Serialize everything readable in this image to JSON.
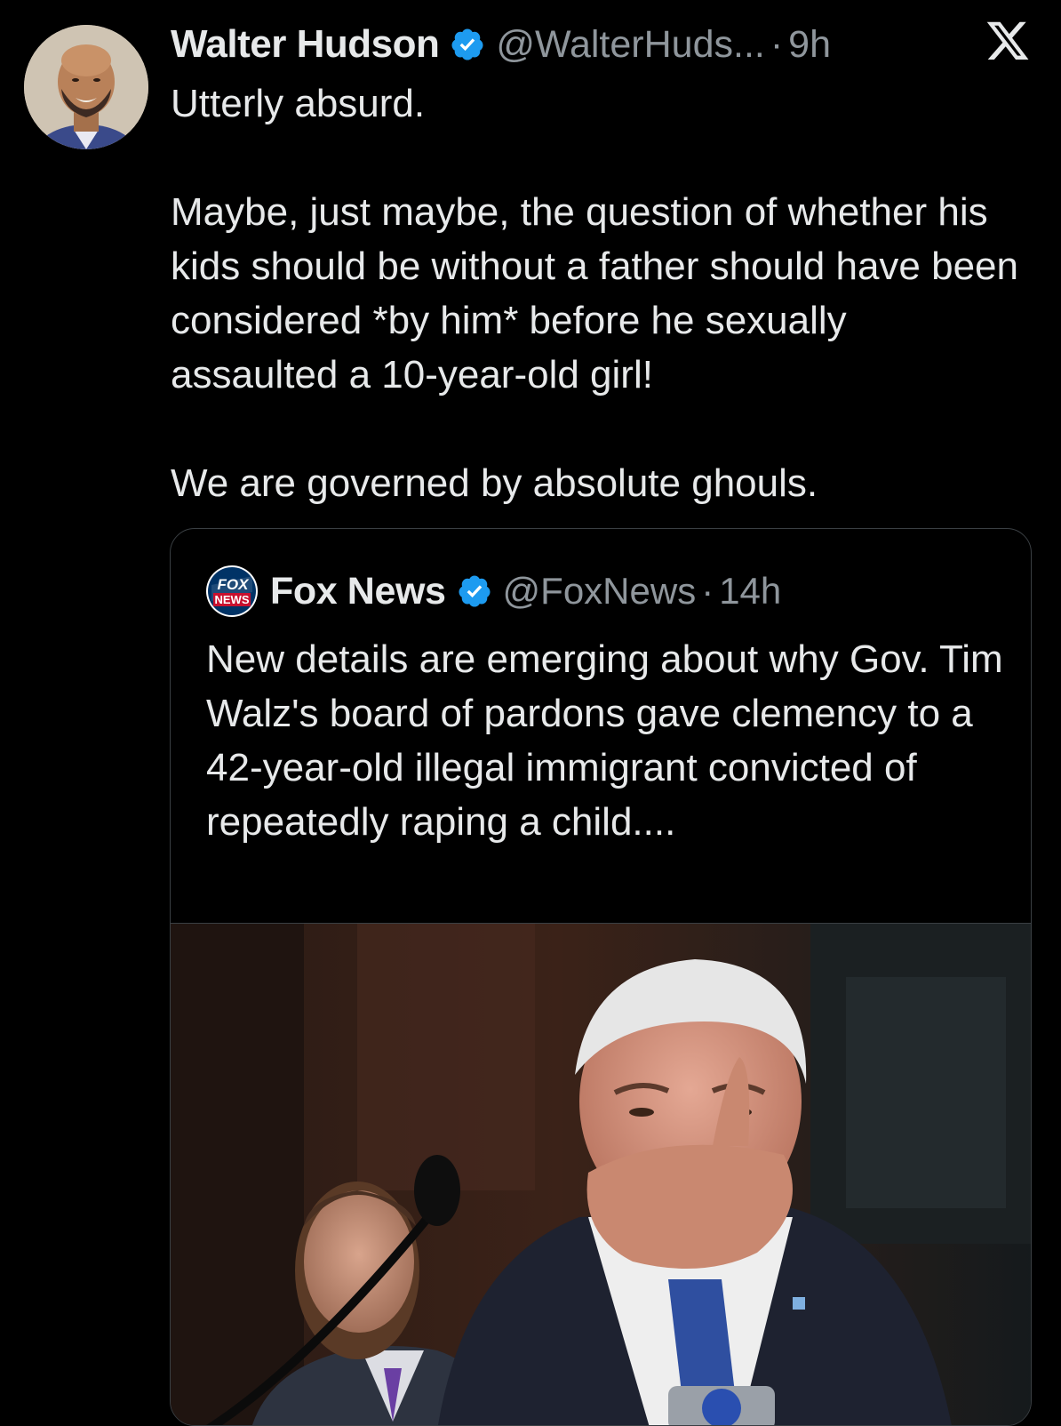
{
  "tweet": {
    "author": {
      "display_name": "Walter Hudson",
      "handle": "@WalterHuds...",
      "separator": "·",
      "time": "9h",
      "verified_icon": "verified-badge-icon",
      "avatar_icon": "avatar"
    },
    "platform_icon": "x-logo-icon",
    "text": {
      "p1": "Utterly absurd.",
      "p2": "Maybe, just maybe, the question of whether his kids should be without a father should have been considered *by him* before he sexually assaulted a 10-year-old girl!",
      "p3": "We are governed by absolute ghouls."
    },
    "quote": {
      "author": {
        "display_name": "Fox News",
        "handle": "@FoxNews",
        "separator": "·",
        "time": "14h",
        "logo_text_top": "FOX",
        "logo_text_bottom": "NEWS"
      },
      "text": "New details are emerging about why Gov. Tim Walz's board of pardons gave clemency to a 42-year-old illegal immigrant convicted of repeatedly raping a child....",
      "media_icon": "news-photo"
    }
  },
  "colors": {
    "background": "#000000",
    "text_primary": "#e7e9ea",
    "text_secondary": "#8f969c",
    "verified_blue": "#1d9bf0",
    "border": "#3a3f43"
  }
}
